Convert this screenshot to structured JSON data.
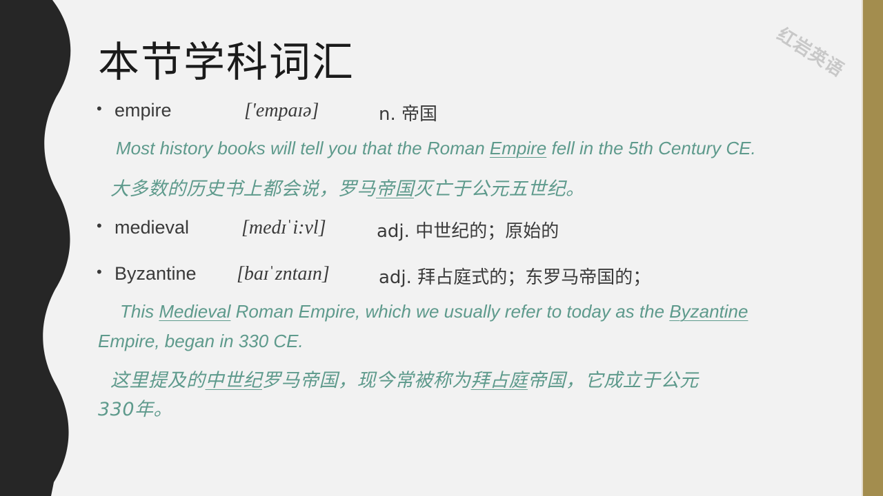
{
  "slide": {
    "title": "本节学科词汇",
    "watermark": "红岩英语",
    "colors": {
      "accent_teal": "#5e9a8c",
      "side_bar_gold": "#a38d4e",
      "wave_dark": "#262626",
      "background": "#f2f2f2"
    }
  },
  "vocab": [
    {
      "word": "empire",
      "phonetic": "['empaɪə]",
      "meaning": "n. 帝国"
    },
    {
      "word": "medieval",
      "phonetic": "[medɪˈi:vl]",
      "meaning": "adj. 中世纪的；原始的"
    },
    {
      "word": "Byzantine",
      "phonetic": "[baɪˈzntaɪn]",
      "meaning": "adj. 拜占庭式的；东罗马帝国的；"
    }
  ],
  "examples": {
    "ex1_en": {
      "pre": "Most history books will tell you that the Roman ",
      "u1": "Empire",
      "post": " fell in the 5th Century CE."
    },
    "ex1_cn": {
      "pre": "大多数的历史书上都会说，罗马",
      "u1": "帝国",
      "post": "灭亡于公元五世纪。"
    },
    "ex2_en": {
      "pre": "This ",
      "u1": "Medieval",
      "mid": " Roman Empire, which we usually refer to today as the ",
      "u2": "Byzantine",
      "line2": "Empire,  began in 330 CE."
    },
    "ex2_cn": {
      "pre": "这里提及的",
      "u1": "中世纪",
      "mid": "罗马帝国，现今常被称为",
      "u2": "拜占庭",
      "post": "帝国，它成立于公元",
      "line2": "330年。"
    }
  }
}
